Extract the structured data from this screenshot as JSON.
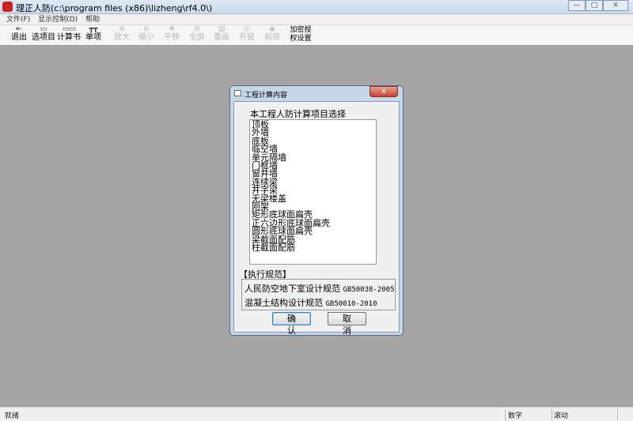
{
  "window": {
    "title": "理正人防(c:\\program files (x86)\\lizheng\\rf4.0\\)",
    "controls": {
      "minimize": "—",
      "maximize": "□",
      "close": "✕"
    }
  },
  "menu": [
    "文件(F)",
    "显示控制(D)",
    "帮助"
  ],
  "toolbar": [
    {
      "label": "退出",
      "icon": "exit-icon",
      "glyph": "⇤",
      "enabled": true
    },
    {
      "label": "选项目",
      "icon": "select-project-icon",
      "glyph": "▭",
      "enabled": true
    },
    {
      "label": "计算书",
      "icon": "calc-book-icon",
      "glyph": "▭▭",
      "enabled": true
    },
    {
      "label": "单项",
      "icon": "single-item-icon",
      "glyph": "┳┳",
      "enabled": true
    },
    {
      "label": "放大",
      "icon": "zoom-in-icon",
      "glyph": "⊕",
      "enabled": false
    },
    {
      "label": "缩小",
      "icon": "zoom-out-icon",
      "glyph": "⊖",
      "enabled": false
    },
    {
      "label": "平移",
      "icon": "pan-icon",
      "glyph": "✥",
      "enabled": false
    },
    {
      "label": "全屏",
      "icon": "fullscreen-icon",
      "glyph": "⊞",
      "enabled": false
    },
    {
      "label": "重画",
      "icon": "redraw-icon",
      "glyph": "▤",
      "enabled": false
    },
    {
      "label": "开窗",
      "icon": "window-icon",
      "glyph": "◎",
      "enabled": false
    },
    {
      "label": "前视",
      "icon": "front-view-icon",
      "glyph": "◉",
      "enabled": false
    },
    {
      "label": "加密授权设置",
      "icon": "license-icon",
      "glyph": "",
      "enabled": true
    }
  ],
  "dialog": {
    "title": "工程计算内容",
    "close": "x",
    "list_label": "本工程人防计算项目选择",
    "items": [
      "顶板",
      "外墙",
      "底板",
      "临空墙",
      "单元隔墙",
      "门框墙",
      "窗井墙",
      "连续梁",
      "井字梁",
      "无梁楼盖",
      "刚架",
      "矩形底球面扁壳",
      "正六边形底球面扁壳",
      "圆形底球面扁壳",
      "梁截面配筋",
      "柱截面配筋"
    ],
    "codes_label": "【执行规范】",
    "codes": [
      {
        "name": "人民防空地下室设计规范",
        "code": "GB50038-2005"
      },
      {
        "name": "混凝土结构设计规范",
        "code": "GB50010-2010"
      }
    ],
    "ok": "确认",
    "cancel": "取消"
  },
  "status": {
    "ready": "就绪",
    "num": "数字",
    "scroll": "滚动"
  }
}
